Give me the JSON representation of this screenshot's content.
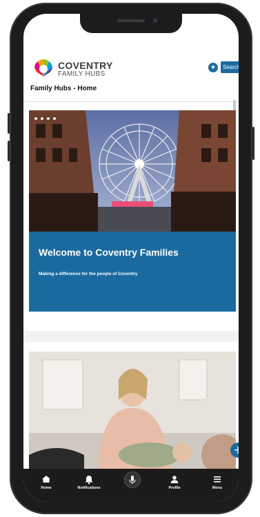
{
  "header": {
    "brand_line1": "COVENTRY",
    "brand_line2": "FAMILY HUBS",
    "search_label": "Search",
    "favourite_icon": "star-icon",
    "search_icon": "search-icon",
    "page_title": "Family Hubs - Home"
  },
  "hero": {
    "slide_count": 4,
    "welcome_title": "Welcome to Coventry Families",
    "welcome_subtitle": "Making a difference for the people of Coventry"
  },
  "fab": {
    "icon": "plus-icon"
  },
  "tabbar": {
    "items": [
      {
        "label": "Home",
        "icon": "home-icon"
      },
      {
        "label": "Notifications",
        "icon": "bell-icon"
      },
      {
        "label": "",
        "icon": "microphone-icon"
      },
      {
        "label": "Profile",
        "icon": "person-icon"
      },
      {
        "label": "Menu",
        "icon": "hamburger-icon"
      }
    ]
  },
  "colors": {
    "brand_blue": "#1b6a9f",
    "tabbar_bg": "#1b1b1b",
    "phone_frame": "#1c1c1e"
  }
}
